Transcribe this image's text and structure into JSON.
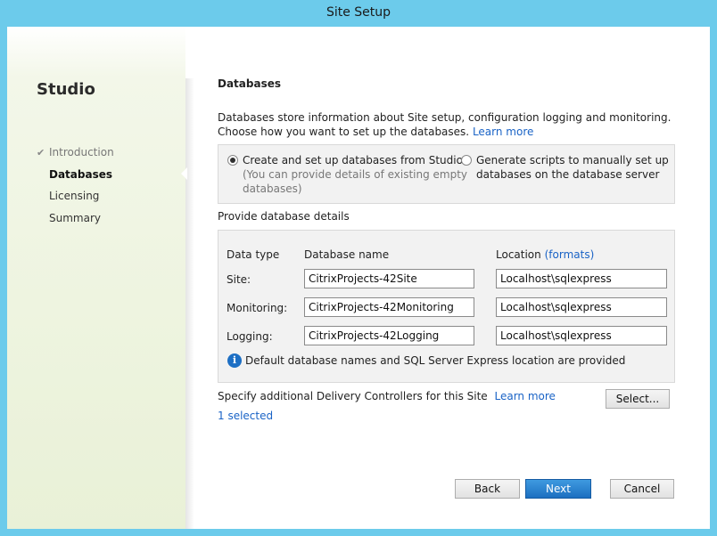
{
  "window": {
    "title": "Site Setup"
  },
  "sidebar": {
    "app_title": "Studio",
    "steps": [
      {
        "label": "Introduction",
        "state": "done"
      },
      {
        "label": "Databases",
        "state": "active"
      },
      {
        "label": "Licensing",
        "state": "pending"
      },
      {
        "label": "Summary",
        "state": "pending"
      }
    ],
    "check_glyph": "✔"
  },
  "main": {
    "heading": "Databases",
    "description_line1": "Databases store information about Site setup, configuration logging and monitoring.",
    "description_line2": "Choose how you want to set up the databases.",
    "learn_more": "Learn more",
    "options": [
      {
        "line1": "Create and set up databases from Studio",
        "line2": "(You can provide details of existing empty",
        "line3": "databases)",
        "selected": true
      },
      {
        "line1": "Generate scripts to manually set up",
        "line2": "databases on the database server",
        "selected": false
      }
    ],
    "provide_label": "Provide database details",
    "table": {
      "col_type": "Data type",
      "col_name": "Database name",
      "col_location": "Location",
      "formats_link": "(formats)",
      "rows": [
        {
          "type": "Site:",
          "name": "CitrixProjects-42Site",
          "location": "Localhost\\sqlexpress"
        },
        {
          "type": "Monitoring:",
          "name": "CitrixProjects-42Monitoring",
          "location": "Localhost\\sqlexpress"
        },
        {
          "type": "Logging:",
          "name": "CitrixProjects-42Logging",
          "location": "Localhost\\sqlexpress"
        }
      ],
      "info_icon_glyph": "i",
      "info_text": "Default database names and SQL Server Express location are provided"
    },
    "controllers_text": "Specify additional Delivery Controllers for this Site",
    "controllers_learn_more": "Learn more",
    "select_button": "Select...",
    "selected_count": "1 selected"
  },
  "footer": {
    "back": "Back",
    "next": "Next",
    "cancel": "Cancel"
  },
  "colors": {
    "frame": "#6ccbeb",
    "link": "#1a63c6",
    "primary": "#1c6fc0"
  }
}
